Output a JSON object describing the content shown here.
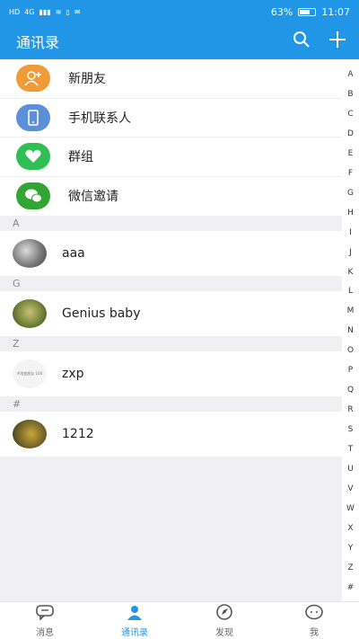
{
  "status": {
    "left": [
      "HD",
      "4G",
      "▮▮▮",
      "≋",
      "▯",
      "✉"
    ],
    "battery": "63%",
    "time": "11:07"
  },
  "header": {
    "title": "通讯录"
  },
  "top_items": [
    {
      "label": "新朋友",
      "icon": "person-add-icon",
      "color": "#f19a38"
    },
    {
      "label": "手机联系人",
      "icon": "phone-icon",
      "color": "#5b8fd8"
    },
    {
      "label": "群组",
      "icon": "heart-group-icon",
      "color": "#2fbf55"
    },
    {
      "label": "微信邀请",
      "icon": "wechat-icon",
      "color": "#33a534"
    }
  ],
  "sections": [
    {
      "letter": "A",
      "contacts": [
        {
          "name": "aaa"
        }
      ]
    },
    {
      "letter": "G",
      "contacts": [
        {
          "name": "Genius baby"
        }
      ]
    },
    {
      "letter": "Z",
      "contacts": [
        {
          "name": "zxp",
          "avatar_text": "#改变朋友 100"
        }
      ]
    },
    {
      "letter": "#",
      "contacts": [
        {
          "name": "1212"
        }
      ]
    }
  ],
  "index_letters": [
    "A",
    "B",
    "C",
    "D",
    "E",
    "F",
    "G",
    "H",
    "I",
    "J",
    "K",
    "L",
    "M",
    "N",
    "O",
    "P",
    "Q",
    "R",
    "S",
    "T",
    "U",
    "V",
    "W",
    "X",
    "Y",
    "Z",
    "#"
  ],
  "tabs": [
    {
      "label": "消息",
      "icon": "chat-icon",
      "active": false
    },
    {
      "label": "通讯录",
      "icon": "contacts-icon",
      "active": true
    },
    {
      "label": "发现",
      "icon": "compass-icon",
      "active": false
    },
    {
      "label": "我",
      "icon": "profile-icon",
      "active": false
    }
  ],
  "colors": {
    "accent": "#2196e6"
  }
}
